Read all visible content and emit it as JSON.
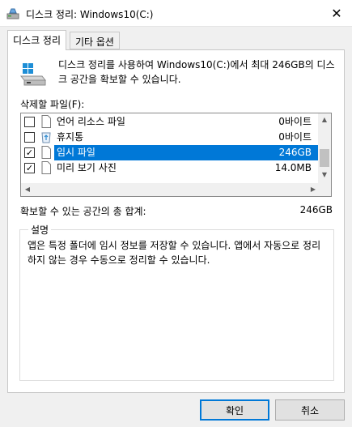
{
  "window": {
    "title": "디스크 정리: Windows10(C:)",
    "close_label": "✕",
    "app_icon": "disk-cleanup-icon"
  },
  "tabs": [
    {
      "label": "디스크 정리",
      "active": true
    },
    {
      "label": "기타 옵션",
      "active": false
    }
  ],
  "intro": {
    "text": "디스크 정리를 사용하여 Windows10(C:)에서 최대 246GB의 디스크 공간을 확보할 수 있습니다.",
    "icon": "drive-icon"
  },
  "files": {
    "label": "삭제할 파일(F):",
    "items": [
      {
        "name": "언어 리소스 파일",
        "size": "0바이트",
        "checked": false,
        "selected": false,
        "icon": "file-icon"
      },
      {
        "name": "휴지통",
        "size": "0바이트",
        "checked": false,
        "selected": false,
        "icon": "recycle-bin-icon"
      },
      {
        "name": "임시 파일",
        "size": "246GB",
        "checked": true,
        "selected": true,
        "icon": "file-icon"
      },
      {
        "name": "미리 보기 사진",
        "size": "14.0MB",
        "checked": true,
        "selected": false,
        "icon": "file-icon"
      }
    ],
    "vscroll_position": 0.8
  },
  "total": {
    "label": "확보할 수 있는 공간의 총 합계:",
    "value": "246GB"
  },
  "description": {
    "legend": "설명",
    "text": "앱은 특정 폴더에 임시 정보를 저장할 수 있습니다. 앱에서 자동으로 정리하지 않는 경우 수동으로 정리할 수 있습니다."
  },
  "buttons": {
    "ok": "확인",
    "cancel": "취소"
  },
  "colors": {
    "selection": "#0078d7",
    "recycle": "#2e8bd0"
  }
}
